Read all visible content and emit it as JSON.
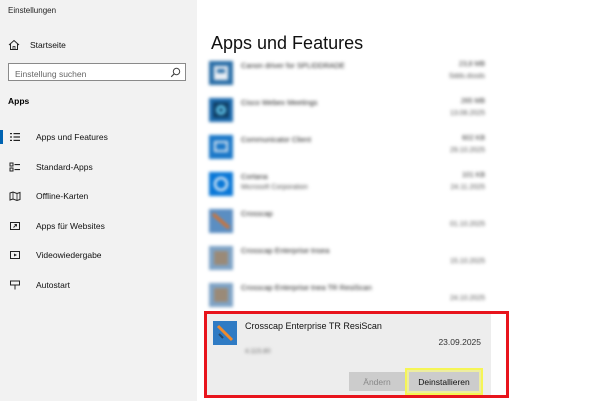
{
  "window": {
    "title": "Einstellungen"
  },
  "sidebar": {
    "home_label": "Startseite",
    "search_placeholder": "Einstellung suchen",
    "section_label": "Apps",
    "items": [
      {
        "label": "Apps und Features",
        "icon": "list-icon",
        "active": true
      },
      {
        "label": "Standard-Apps",
        "icon": "default-apps-icon"
      },
      {
        "label": "Offline-Karten",
        "icon": "map-icon"
      },
      {
        "label": "Apps für Websites",
        "icon": "website-link-icon"
      },
      {
        "label": "Videowiedergabe",
        "icon": "video-icon"
      },
      {
        "label": "Autostart",
        "icon": "autostart-icon"
      }
    ]
  },
  "main": {
    "title": "Apps und Features",
    "apps": [
      {
        "name": "Canon driver for SPLIDDRADE",
        "publisher": "",
        "size": "23,8 MB",
        "date": "Sdds.dssds"
      },
      {
        "name": "Cisco Webex Meetings",
        "publisher": "",
        "size": "265 MB",
        "date": "13.08.2025"
      },
      {
        "name": "Communicator Client",
        "publisher": "",
        "size": "602 KB",
        "date": "29.10.2025"
      },
      {
        "name": "Cortana",
        "publisher": "Microsoft Corporation",
        "size": "101 KB",
        "date": "24.11.2025"
      },
      {
        "name": "Crosscap",
        "publisher": "",
        "size": "",
        "date": "01.10.2025"
      },
      {
        "name": "Crosscap Enterprise tnsea",
        "publisher": "",
        "size": "",
        "date": "15.10.2025"
      },
      {
        "name": "Crosscap Enterprise tnea TR ResiScan",
        "publisher": "",
        "size": "",
        "date": "24.10.2025"
      }
    ],
    "selected": {
      "name": "Crosscap Enterprise TR ResiScan",
      "version": "4.11S.80",
      "date": "23.09.2025",
      "change_label": "Ändern",
      "uninstall_label": "Deinstallieren"
    }
  },
  "colors": {
    "accent": "#0063b1",
    "highlight_frame": "#e8141c",
    "uninstall_highlight": "#f5f556"
  }
}
